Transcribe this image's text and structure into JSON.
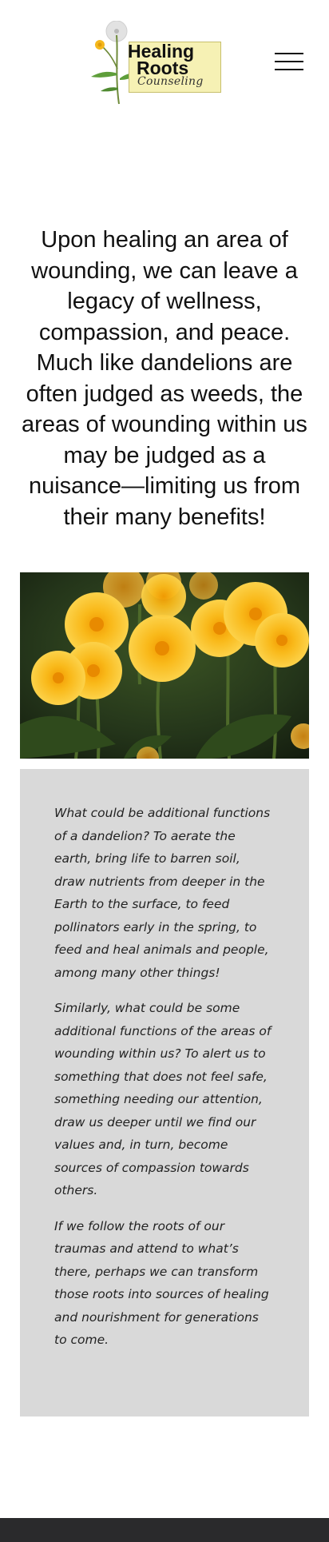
{
  "header": {
    "logo": {
      "line1": "Healing",
      "line2": "Roots",
      "line3": "Counseling"
    },
    "menu_icon": "hamburger-menu-icon"
  },
  "main": {
    "headline": "Upon healing an area of wounding, we can leave a legacy of wellness, compassion, and peace. Much like dandelions are often judged as weeds, the areas of wounding within us may be judged as a nuisance—limiting us from their many benefits!",
    "image": "dandelion-flowers-photo",
    "quote": {
      "paragraphs": [
        "What could be additional functions of a dandelion? To aerate the earth, bring life to barren soil, draw nutrients from deeper in the Earth to the surface, to feed pollinators early in the spring, to feed and heal animals and people, among many other things!",
        "Similarly, what could be some additional functions of the areas of wounding within us? To alert us to something that does not feel safe, something needing our attention, draw us deeper until we find our values and, in turn, become sources of compassion towards others.",
        "If we follow the roots of our traumas and attend to what’s there, perhaps we can transform those roots into sources of healing and nourishment for generations to come."
      ]
    }
  },
  "colors": {
    "quote_background": "#d9d9d9",
    "logo_background": "#f6f1b4",
    "footer": "#2a2a2c",
    "dandelion": "#f5b81c"
  }
}
